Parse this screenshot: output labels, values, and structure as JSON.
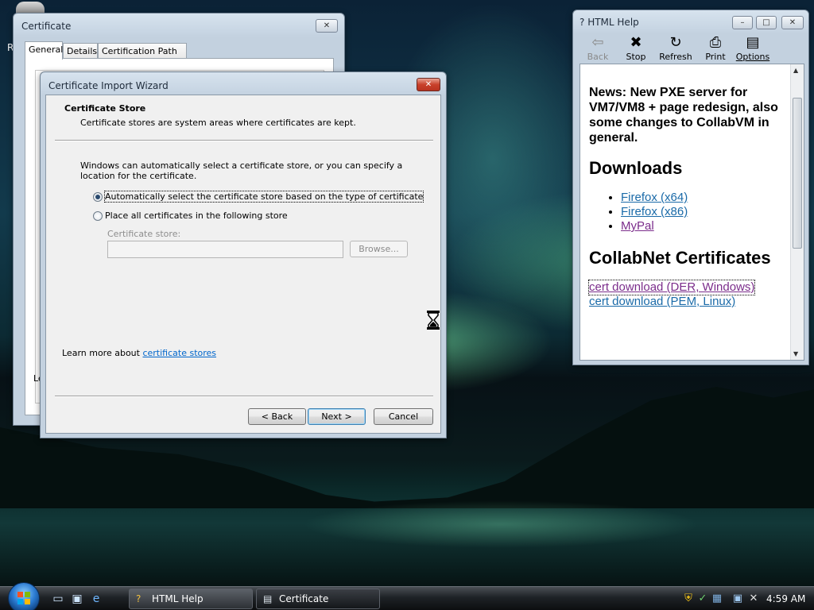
{
  "desktop": {
    "partial_letter": "R"
  },
  "certificate_window": {
    "title": "Certificate",
    "close_label": "✕",
    "tabs": [
      "General",
      "Details",
      "Certification Path"
    ],
    "partial_text": "Le"
  },
  "wizard": {
    "title": "Certificate Import Wizard",
    "close_label": "✕",
    "header_title": "Certificate Store",
    "header_subtitle": "Certificate stores are system areas where certificates are kept.",
    "description": "Windows can automatically select a certificate store, or you can specify a location for the certificate.",
    "option_auto": "Automatically select the certificate store based on the type of certificate",
    "option_manual": "Place all certificates in the following store",
    "store_label": "Certificate store:",
    "store_value": "",
    "browse_label": "Browse...",
    "learn_prefix": "Learn more about ",
    "learn_link": "certificate stores",
    "back_label": "< Back",
    "next_label": "Next >",
    "cancel_label": "Cancel"
  },
  "help_window": {
    "title": "HTML Help",
    "toolbar": [
      {
        "label": "Back",
        "icon": "⇦"
      },
      {
        "label": "Stop",
        "icon": "✖"
      },
      {
        "label": "Refresh",
        "icon": "↻"
      },
      {
        "label": "Print",
        "icon": "⎙"
      },
      {
        "label": "Options",
        "icon": "▤"
      }
    ],
    "news": "News: New PXE server for VM7/VM8 + page redesign, also some changes to CollabVM in general.",
    "downloads_heading": "Downloads",
    "downloads": [
      "Firefox (x64)",
      "Firefox (x86)",
      "MyPal"
    ],
    "certs_heading": "CollabNet Certificates",
    "cert_links": [
      "cert download (DER, Windows)",
      "cert download (PEM, Linux)"
    ]
  },
  "taskbar": {
    "buttons": [
      "HTML Help",
      "Certificate"
    ],
    "clock": "4:59 AM"
  }
}
